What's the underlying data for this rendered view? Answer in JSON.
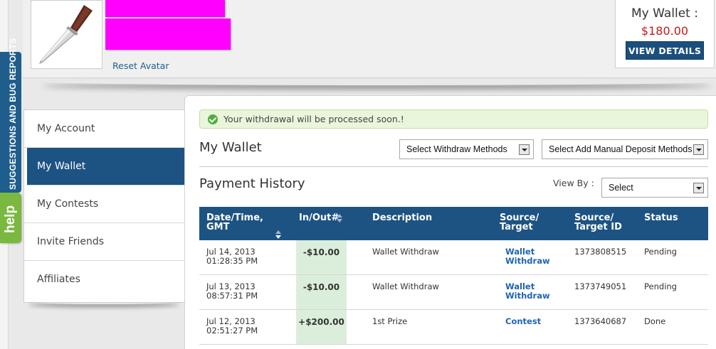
{
  "feedback": {
    "label": "SUGGESTIONS AND BUG REPORTS",
    "help_label": "help"
  },
  "header": {
    "reset_avatar": "Reset Avatar",
    "wallet": {
      "title": "My Wallet :",
      "amount": "$180.00",
      "view_details": "VIEW DETAILS"
    }
  },
  "sidebar": {
    "items": [
      {
        "label": "My Account"
      },
      {
        "label": "My Wallet"
      },
      {
        "label": "My Contests"
      },
      {
        "label": "Invite Friends"
      },
      {
        "label": "Affiliates"
      }
    ]
  },
  "main": {
    "alert": "Your withdrawal will be processed soon.!",
    "wallet_title": "My Wallet",
    "withdraw_select": "Select Withdraw Methods",
    "deposit_select": "Select Add Manual Deposit Methods",
    "history_title": "Payment History",
    "view_by_label": "View By :",
    "view_by_value": "Select"
  },
  "table": {
    "headers": {
      "date": [
        "Date/Time,",
        "GMT"
      ],
      "inout": "In/Out#",
      "description": "Description",
      "source": [
        "Source/",
        "Target"
      ],
      "source_id": [
        "Source/",
        "Target ID"
      ],
      "status": "Status"
    },
    "rows": [
      {
        "date": "Jul 14, 2013",
        "time": "01:28:35 PM",
        "amount": "-$10.00",
        "description": "Wallet Withdraw",
        "source1": "Wallet",
        "source2": "Withdraw",
        "target_id": "1373808515",
        "status": "Pending"
      },
      {
        "date": "Jul 13, 2013",
        "time": "08:57:31 PM",
        "amount": "-$10.00",
        "description": "Wallet Withdraw",
        "source1": "Wallet",
        "source2": "Withdraw",
        "target_id": "1373749051",
        "status": "Pending"
      },
      {
        "date": "Jul 12, 2013",
        "time": "02:51:27 PM",
        "amount": "+$200.00",
        "description": "1st Prize",
        "source1": "Contest",
        "source2": "",
        "target_id": "1373640687",
        "status": "Done"
      }
    ]
  },
  "colors": {
    "accent": "#1d5383",
    "wallet_amount": "#c41a1a",
    "redaction": "#ff00ff",
    "help": "#7ab83f"
  }
}
